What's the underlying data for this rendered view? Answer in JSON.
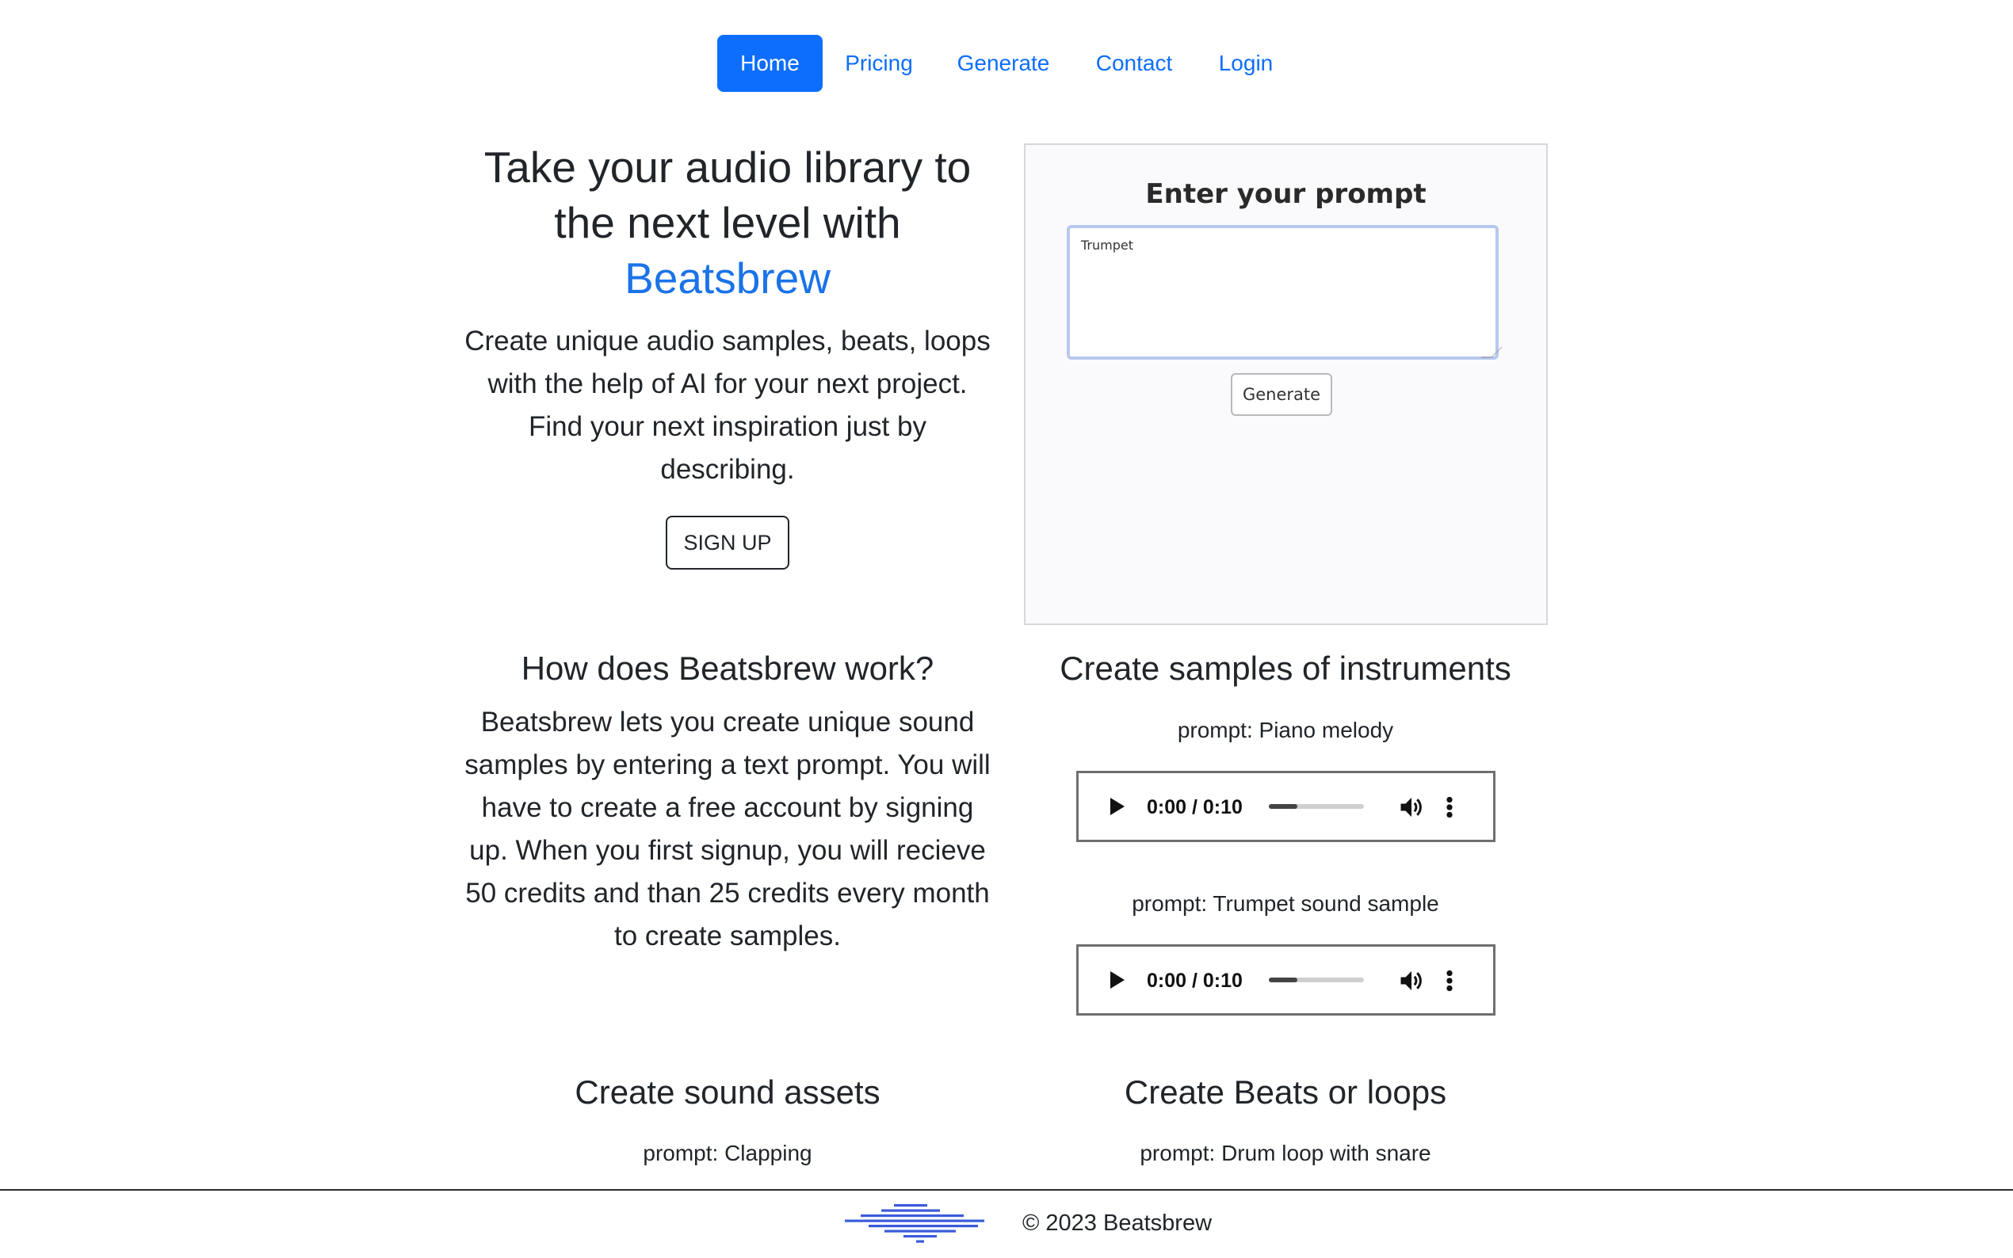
{
  "nav": {
    "items": [
      {
        "label": "Home",
        "active": true
      },
      {
        "label": "Pricing",
        "active": false
      },
      {
        "label": "Generate",
        "active": false
      },
      {
        "label": "Contact",
        "active": false
      },
      {
        "label": "Login",
        "active": false
      }
    ]
  },
  "hero": {
    "title_line1": "Take your audio library to",
    "title_line2": "the next level with",
    "brand": "Beatsbrew",
    "description": "Create unique audio samples, beats, loops with the help of AI for your next project. Find your next inspiration just by describing.",
    "signup_label": "SIGN UP"
  },
  "prompt_panel": {
    "title": "Enter your prompt",
    "input_value": "Trumpet",
    "generate_label": "Generate"
  },
  "how_it_works": {
    "title": "How does Beatsbrew work?",
    "text": "Beatsbrew lets you create unique sound samples by entering a text prompt. You will have to create a free account by signing up. When you first signup, you will recieve 50 credits and than 25 credits every month to create samples."
  },
  "instruments": {
    "title": "Create samples of instruments",
    "samples": [
      {
        "prompt": "prompt: Piano melody",
        "time": "0:00 / 0:10",
        "progress": 0.3
      },
      {
        "prompt": "prompt: Trumpet sound sample",
        "time": "0:00 / 0:10",
        "progress": 0.3
      }
    ]
  },
  "sound_assets": {
    "title": "Create sound assets",
    "prompt": "prompt: Clapping"
  },
  "beats": {
    "title": "Create Beats or loops",
    "prompt": "prompt: Drum loop with snare"
  },
  "footer": {
    "copyright": "© 2023 Beatsbrew",
    "logo_color": "#3b5bdb"
  },
  "colors": {
    "primary": "#0d6efd",
    "brand_text": "#1a73e8"
  }
}
